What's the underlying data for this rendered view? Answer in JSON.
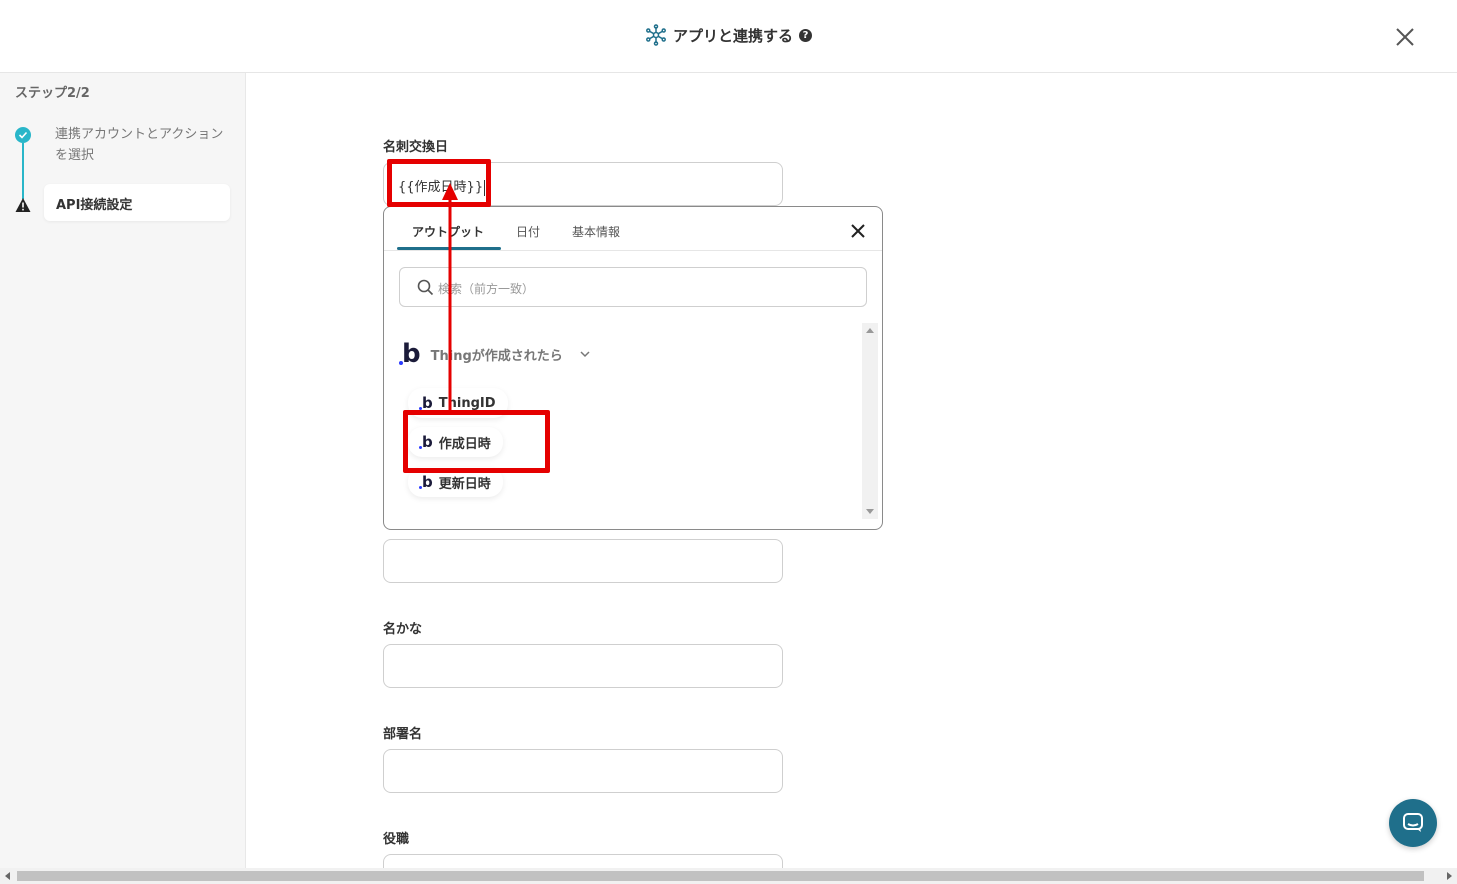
{
  "header": {
    "title": "アプリと連携する",
    "help": "?"
  },
  "sidebar": {
    "step_count": "ステップ2/2",
    "steps": [
      {
        "label": "連携アカウントとアクションを選択",
        "status": "done"
      },
      {
        "label": "API接続設定",
        "status": "warning"
      }
    ]
  },
  "fields": [
    {
      "label": "名刺交換日",
      "value": "{{作成日時}}"
    },
    {
      "label": "",
      "value": ""
    },
    {
      "label": "名かな",
      "value": ""
    },
    {
      "label": "部署名",
      "value": ""
    },
    {
      "label": "役職",
      "value": ""
    }
  ],
  "popup": {
    "tabs": [
      {
        "label": "アウトプット",
        "active": true
      },
      {
        "label": "日付",
        "active": false
      },
      {
        "label": "基本情報",
        "active": false
      }
    ],
    "search_placeholder": "検索（前方一致）",
    "group": {
      "icon": "b",
      "label": "Thingが作成されたら"
    },
    "items": [
      {
        "icon": "b",
        "label": "ThingID"
      },
      {
        "icon": "b",
        "label": "作成日時"
      },
      {
        "icon": "b",
        "label": "更新日時"
      }
    ]
  },
  "colors": {
    "accent": "#1f6f8b",
    "step_done": "#29b6c9",
    "highlight": "#e50000"
  }
}
